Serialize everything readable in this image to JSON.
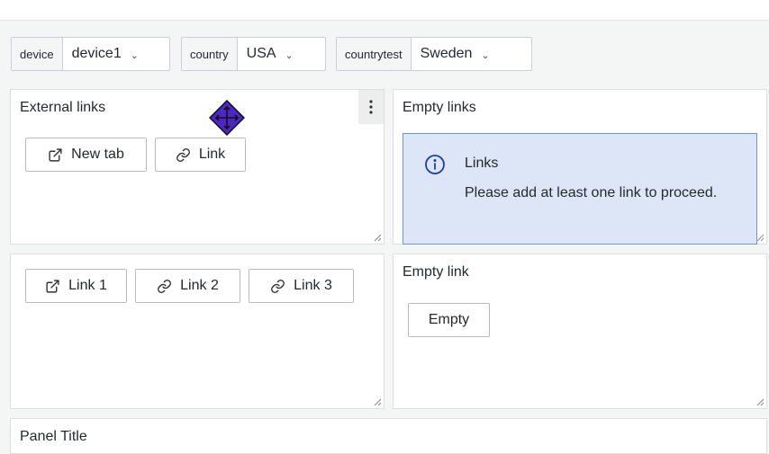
{
  "variables": [
    {
      "label": "device",
      "value": "device1"
    },
    {
      "label": "country",
      "value": "USA"
    },
    {
      "label": "countrytest",
      "value": "Sweden"
    }
  ],
  "panels": {
    "external_links": {
      "title": "External links",
      "buttons": [
        {
          "label": "New tab",
          "icon": "external-link-icon"
        },
        {
          "label": "Link",
          "icon": "link-icon"
        }
      ]
    },
    "empty_links": {
      "title": "Empty links",
      "info_title": "Links",
      "info_body": "Please add at least one link to proceed."
    },
    "links": {
      "buttons": [
        {
          "label": "Link 1",
          "icon": "external-link-icon"
        },
        {
          "label": "Link 2",
          "icon": "link-icon"
        },
        {
          "label": "Link 3",
          "icon": "link-icon"
        }
      ]
    },
    "empty_link": {
      "title": "Empty link",
      "button": "Empty"
    },
    "bottom": {
      "title": "Panel Title"
    }
  },
  "colors": {
    "info_background": "#dde6f7",
    "info_border": "#6e94e0",
    "cursor": "#4c26c7"
  }
}
